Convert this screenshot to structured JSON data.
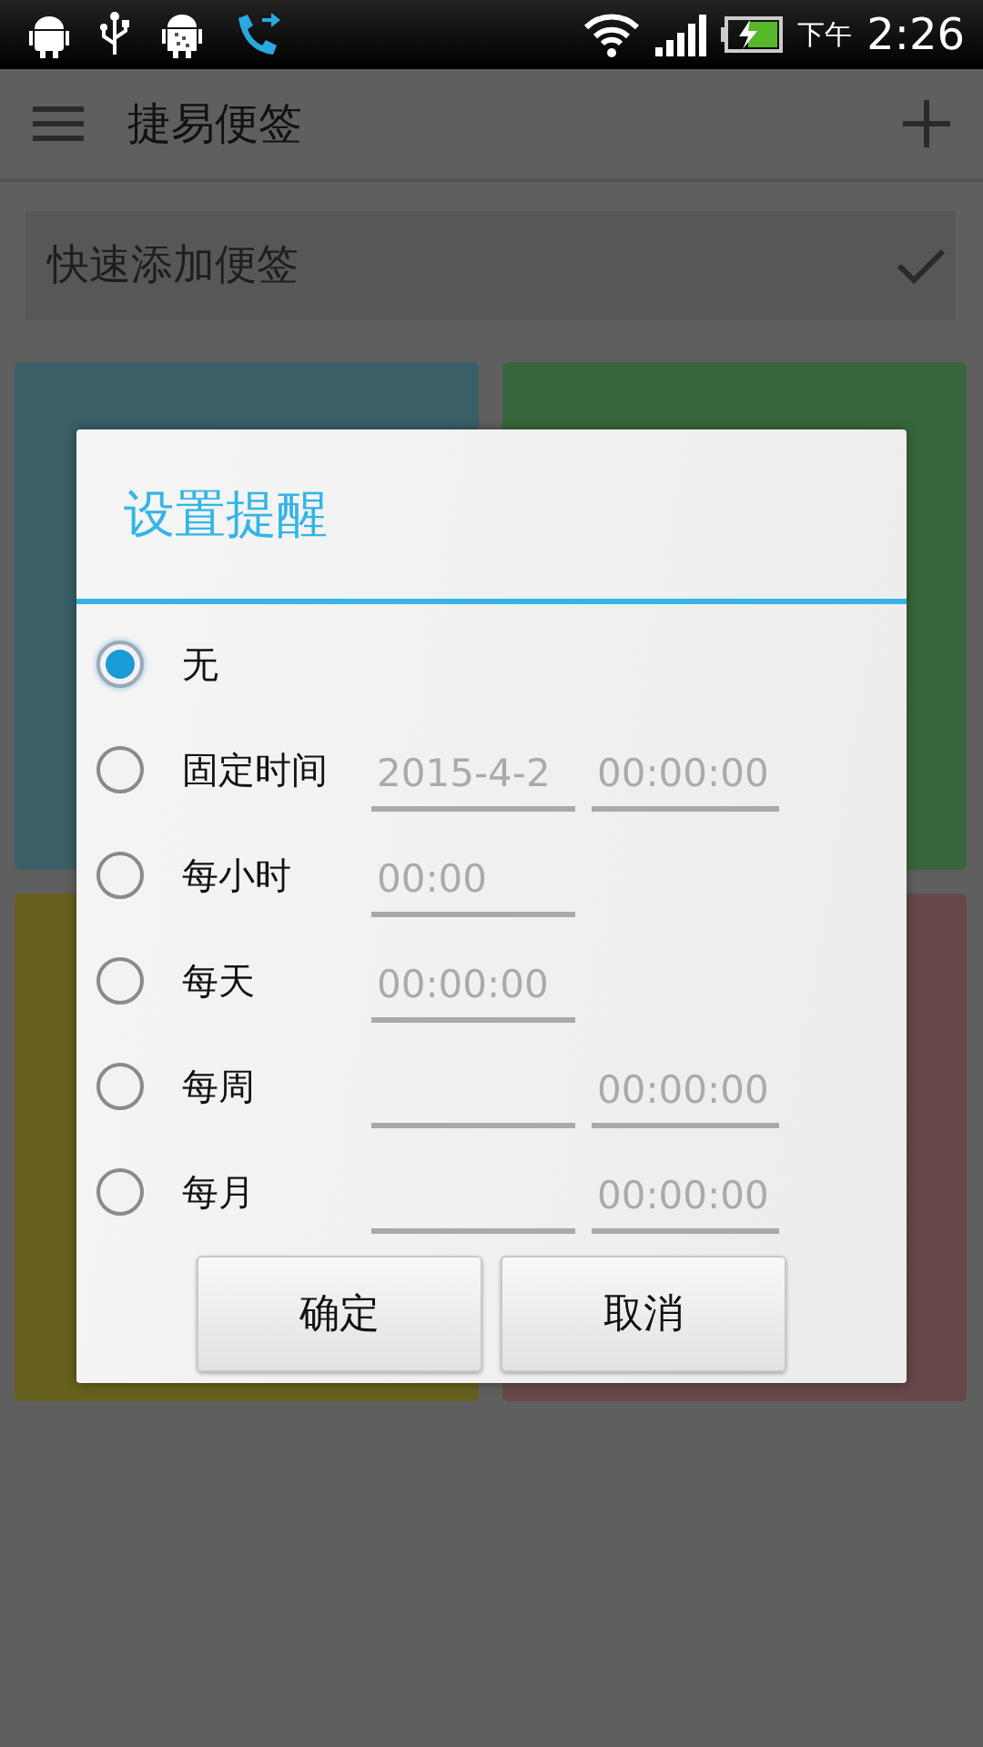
{
  "status_bar": {
    "period": "下午",
    "time": "2:26"
  },
  "app_bar": {
    "title": "捷易便签"
  },
  "quick_add": {
    "placeholder": "快速添加便签"
  },
  "notes": [
    {
      "color": "#3a5f66"
    },
    {
      "color": "#37663a"
    },
    {
      "color": "#66601e"
    },
    {
      "color": "#664848"
    }
  ],
  "dialog": {
    "title": "设置提醒",
    "options": [
      {
        "label": "无",
        "selected": true
      },
      {
        "label": "固定时间",
        "selected": false,
        "fields": [
          {
            "kind": "text",
            "value": "2015-4-2"
          },
          {
            "kind": "text",
            "value": "00:00:00"
          }
        ]
      },
      {
        "label": "每小时",
        "selected": false,
        "fields": [
          {
            "kind": "text",
            "value": "00:00"
          }
        ]
      },
      {
        "label": "每天",
        "selected": false,
        "fields": [
          {
            "kind": "text",
            "value": "00:00:00"
          }
        ]
      },
      {
        "label": "每周",
        "selected": false,
        "fields": [
          {
            "kind": "empty"
          },
          {
            "kind": "text",
            "value": "00:00:00"
          }
        ]
      },
      {
        "label": "每月",
        "selected": false,
        "fields": [
          {
            "kind": "empty"
          },
          {
            "kind": "text",
            "value": "00:00:00"
          }
        ]
      }
    ],
    "buttons": [
      "确定",
      "取消"
    ]
  }
}
